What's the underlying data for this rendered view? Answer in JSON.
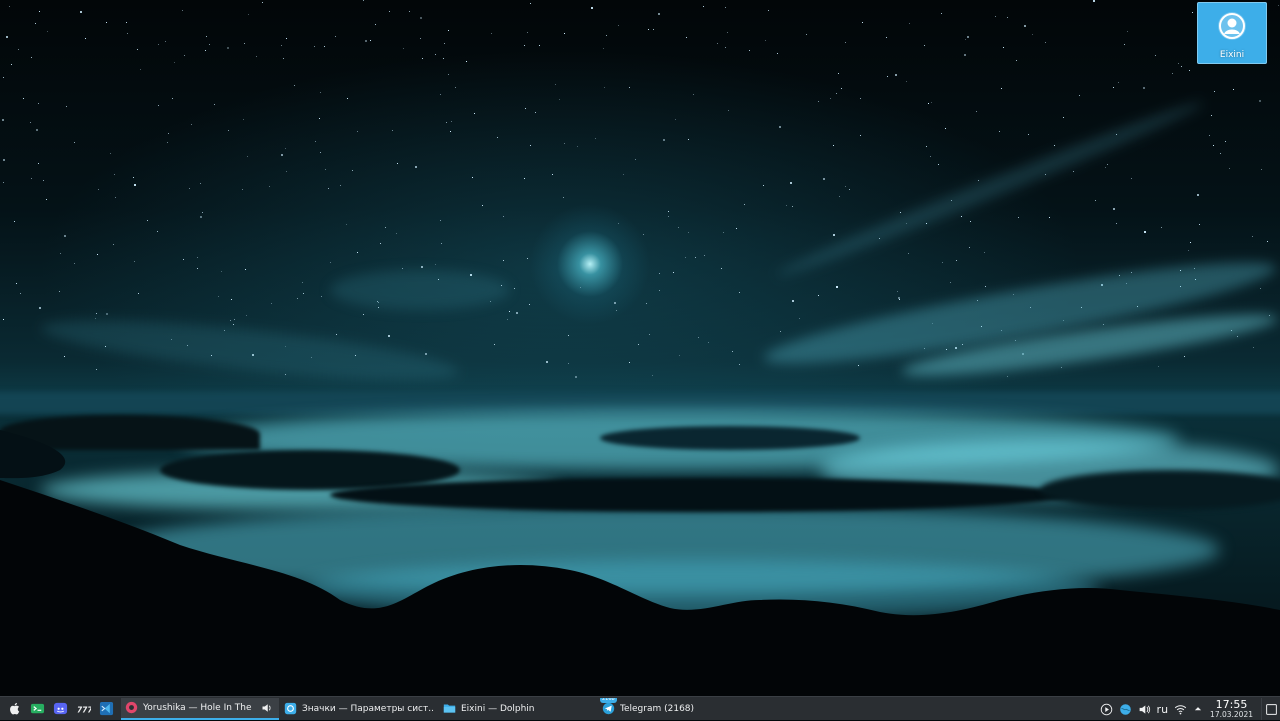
{
  "desktop": {
    "icon": {
      "label": "Eixini",
      "icon": "user-folder-icon"
    }
  },
  "taskbar": {
    "launchers": [
      {
        "name": "app-menu-launcher",
        "icon": "apple-icon"
      },
      {
        "name": "terminal-launcher",
        "icon": "terminal-icon"
      },
      {
        "name": "discord-launcher",
        "icon": "discord-icon"
      },
      {
        "name": "launcher-777",
        "icon": "777-icon"
      },
      {
        "name": "vscode-launcher",
        "icon": "vscode-icon"
      }
    ],
    "tasks": [
      {
        "name": "task-yorushika",
        "label": "Yorushika — Hole In The ...",
        "icon": "music-player-icon",
        "active": true
      },
      {
        "name": "task-settings",
        "label": "Значки  — Параметры сист...",
        "icon": "settings-icon",
        "active": false
      },
      {
        "name": "task-dolphin",
        "label": "Eixini — Dolphin",
        "icon": "folder-icon",
        "active": false
      },
      {
        "name": "task-telegram",
        "label": "Telegram (2168)",
        "icon": "telegram-icon",
        "active": false,
        "badge": "2168"
      }
    ],
    "tray": {
      "language": "ru",
      "time": "17:55",
      "date": "17.03.2021"
    }
  },
  "colors": {
    "accent": "#3daee9",
    "panel": "#2a2e32"
  }
}
